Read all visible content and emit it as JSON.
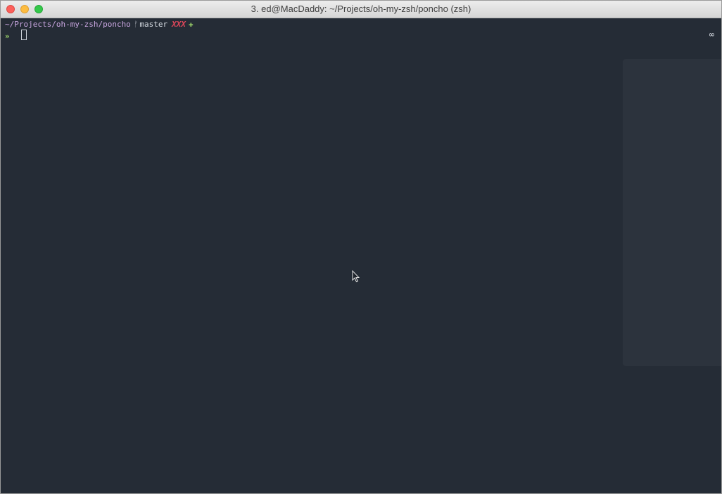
{
  "window": {
    "title": "3. ed@MacDaddy: ~/Projects/oh-my-zsh/poncho (zsh)"
  },
  "terminal": {
    "cwd": "~/Projects/oh-my-zsh/poncho",
    "branch_icon": "git-branch-icon",
    "branch_glyph": "ᚠ",
    "branch": "master",
    "dirty_marker": "XXX",
    "staged_marker": "✚",
    "prompt_symbol": "»",
    "right_prompt": "∞"
  },
  "colors": {
    "background": "#252c36",
    "cwd": "#c9a6e0",
    "dirty": "#e0465a",
    "prompt": "#9bd36a"
  }
}
